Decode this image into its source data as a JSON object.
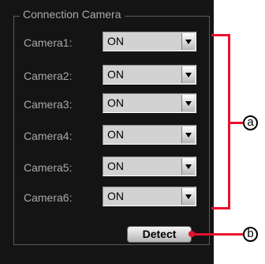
{
  "group": {
    "title": "Connection Camera"
  },
  "cameras": [
    {
      "label": "Camera1:",
      "value": "ON"
    },
    {
      "label": "Camera2:",
      "value": "ON"
    },
    {
      "label": "Camera3:",
      "value": "ON"
    },
    {
      "label": "Camera4:",
      "value": "ON"
    },
    {
      "label": "Camera5:",
      "value": "ON"
    },
    {
      "label": "Camera6:",
      "value": "ON"
    }
  ],
  "detect_button": {
    "label": "Detect"
  },
  "callouts": {
    "a": "a",
    "b": "b"
  },
  "colors": {
    "panel_bg": "#141414",
    "label_text": "#a9a9a9",
    "callout_accent": "#e8112d"
  },
  "icons": {
    "combo_arrow": "chevron-down-icon"
  }
}
